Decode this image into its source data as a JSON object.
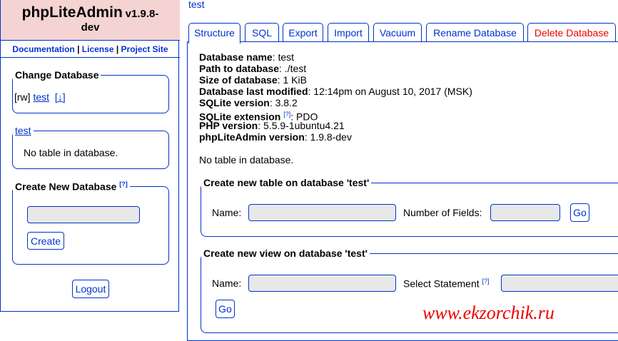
{
  "sidebar": {
    "app_name": "phpLiteAdmin",
    "version": "v1.9.8-",
    "version_suffix": "dev",
    "links": [
      "Documentation",
      "License",
      "Project Site"
    ],
    "change_db": {
      "legend": "Change Database",
      "mode": "[rw]",
      "db_name": "test",
      "download": "[↓]"
    },
    "current_db": {
      "legend": "test",
      "message": "No table in database."
    },
    "create_db": {
      "legend": "Create New Database",
      "help": "[?]",
      "button": "Create"
    },
    "logout": "Logout"
  },
  "breadcrumb": "test",
  "tabs": [
    {
      "label": "Structure"
    },
    {
      "label": "SQL"
    },
    {
      "label": "Export"
    },
    {
      "label": "Import"
    },
    {
      "label": "Vacuum"
    },
    {
      "label": "Rename Database"
    },
    {
      "label": "Delete Database"
    }
  ],
  "info": {
    "db_name_label": "Database name",
    "db_name_value": ": test",
    "path_label": "Path to database",
    "path_value": ": ./test",
    "size_label": "Size of database",
    "size_value": ": 1 KiB",
    "modified_label": "Database last modified",
    "modified_value": ": 12:14pm on August 10, 2017 (MSK)",
    "sqlite_ver_label": "SQLite version",
    "sqlite_ver_value": ": 3.8.2",
    "sqlite_ext_label": "SQLite extension",
    "sqlite_ext_help": "[?]",
    "sqlite_ext_value": ": PDO",
    "php_label": "PHP version",
    "php_value": ": 5.5.9-1ubuntu4.21",
    "pla_label": "phpLiteAdmin version",
    "pla_value": ": 1.9.8-dev",
    "no_table": "No table in database."
  },
  "create_table": {
    "legend": "Create new table on database 'test'",
    "name_label": "Name:",
    "fields_label": "Number of Fields:",
    "go": "Go"
  },
  "create_view": {
    "legend": "Create new view on database 'test'",
    "name_label": "Name:",
    "select_label": "Select Statement",
    "help": "[?]",
    "go": "Go"
  },
  "watermark": "www.ekzorchik.ru",
  "colors": {
    "accent": "#0033cc",
    "logo_bg": "#f5d3d3",
    "danger": "#ee0000"
  }
}
